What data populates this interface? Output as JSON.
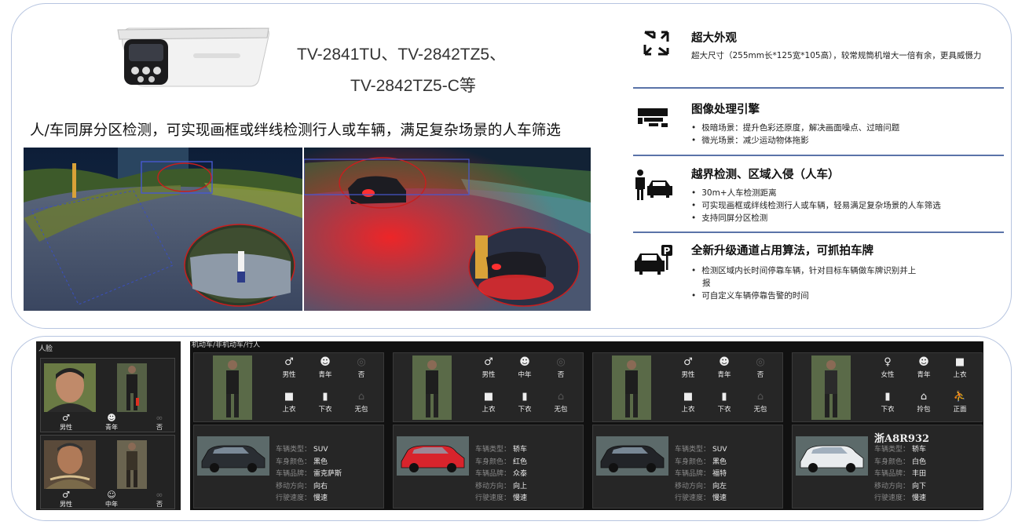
{
  "models": {
    "line1": "TV-2841TU、TV-2842TZ5、",
    "line2": "TV-2842TZ5-C等"
  },
  "headline": "人/车同屏分区检测，可实现画框或绊线检测行人或车辆，满足复杂场景的人车筛选",
  "features": [
    {
      "icon": "expand-icon",
      "title": "超大外观",
      "desc": "超大尺寸（255mm长*125宽*105高），较常规筒机增大一倍有余，更具威慑力"
    },
    {
      "icon": "camera-icon",
      "title": "图像处理引擎",
      "bullets": [
        "极暗场景：提升色彩还原度，解决画面噪点、过暗问题",
        "微光场景：减少运动物体拖影"
      ]
    },
    {
      "icon": "person-car-icon",
      "title": "越界检测、区域入侵（人车）",
      "bullets": [
        "30m+人车检测距离",
        "可实现画框或绊线检测行人或车辆，轻易满足复杂场景的人车筛选",
        "支持同屏分区检测"
      ]
    },
    {
      "icon": "parking-car-icon",
      "title": "全新升级通道占用算法，可抓拍车牌",
      "bullets": [
        "检测区域内长时间停靠车辆，针对目标车辆做车牌识别并上",
        "报",
        "可自定义车辆停靠告警的时间"
      ]
    }
  ],
  "face_panel": {
    "title": "人脸",
    "cards": [
      {
        "gender": "男性",
        "age": "青年",
        "glasses": "否"
      },
      {
        "gender": "男性",
        "age": "中年",
        "glasses": "否"
      }
    ]
  },
  "vehicle_panel": {
    "title": "机动车/非机动车/行人",
    "columns": [
      {
        "person": [
          [
            "男性",
            "青年",
            "否"
          ],
          [
            "上衣",
            "下衣",
            "无包"
          ]
        ],
        "plate": "",
        "car": {
          "labels": [
            "车辆类型：",
            "车身颜色：",
            "车辆品牌：",
            "移动方向：",
            "行驶速度："
          ],
          "values": [
            "SUV",
            "黑色",
            "雷克萨斯",
            "向右",
            "慢速"
          ],
          "color": "#2a2e33"
        }
      },
      {
        "person": [
          [
            "男性",
            "中年",
            "否"
          ],
          [
            "上衣",
            "下衣",
            "无包"
          ]
        ],
        "plate": "",
        "car": {
          "labels": [
            "车辆类型：",
            "车身颜色：",
            "车辆品牌：",
            "移动方向：",
            "行驶速度："
          ],
          "values": [
            "轿车",
            "红色",
            "众泰",
            "向上",
            "慢速"
          ],
          "color": "#d8242c"
        }
      },
      {
        "person": [
          [
            "男性",
            "青年",
            "否"
          ],
          [
            "上衣",
            "下衣",
            "无包"
          ]
        ],
        "plate": "",
        "car": {
          "labels": [
            "车辆类型：",
            "车身颜色：",
            "车辆品牌：",
            "移动方向：",
            "行驶速度："
          ],
          "values": [
            "SUV",
            "黑色",
            "福特",
            "向左",
            "慢速"
          ],
          "color": "#222428"
        }
      },
      {
        "person": [
          [
            "女性",
            "青年",
            "上衣"
          ],
          [
            "下衣",
            "拎包",
            "正面"
          ]
        ],
        "plate": "浙A8R932",
        "car": {
          "labels": [
            "车辆类型：",
            "车身颜色：",
            "车辆品牌：",
            "移动方向：",
            "行驶速度："
          ],
          "values": [
            "轿车",
            "白色",
            "丰田",
            "向下",
            "慢速"
          ],
          "color": "#e9ecee"
        }
      }
    ]
  }
}
